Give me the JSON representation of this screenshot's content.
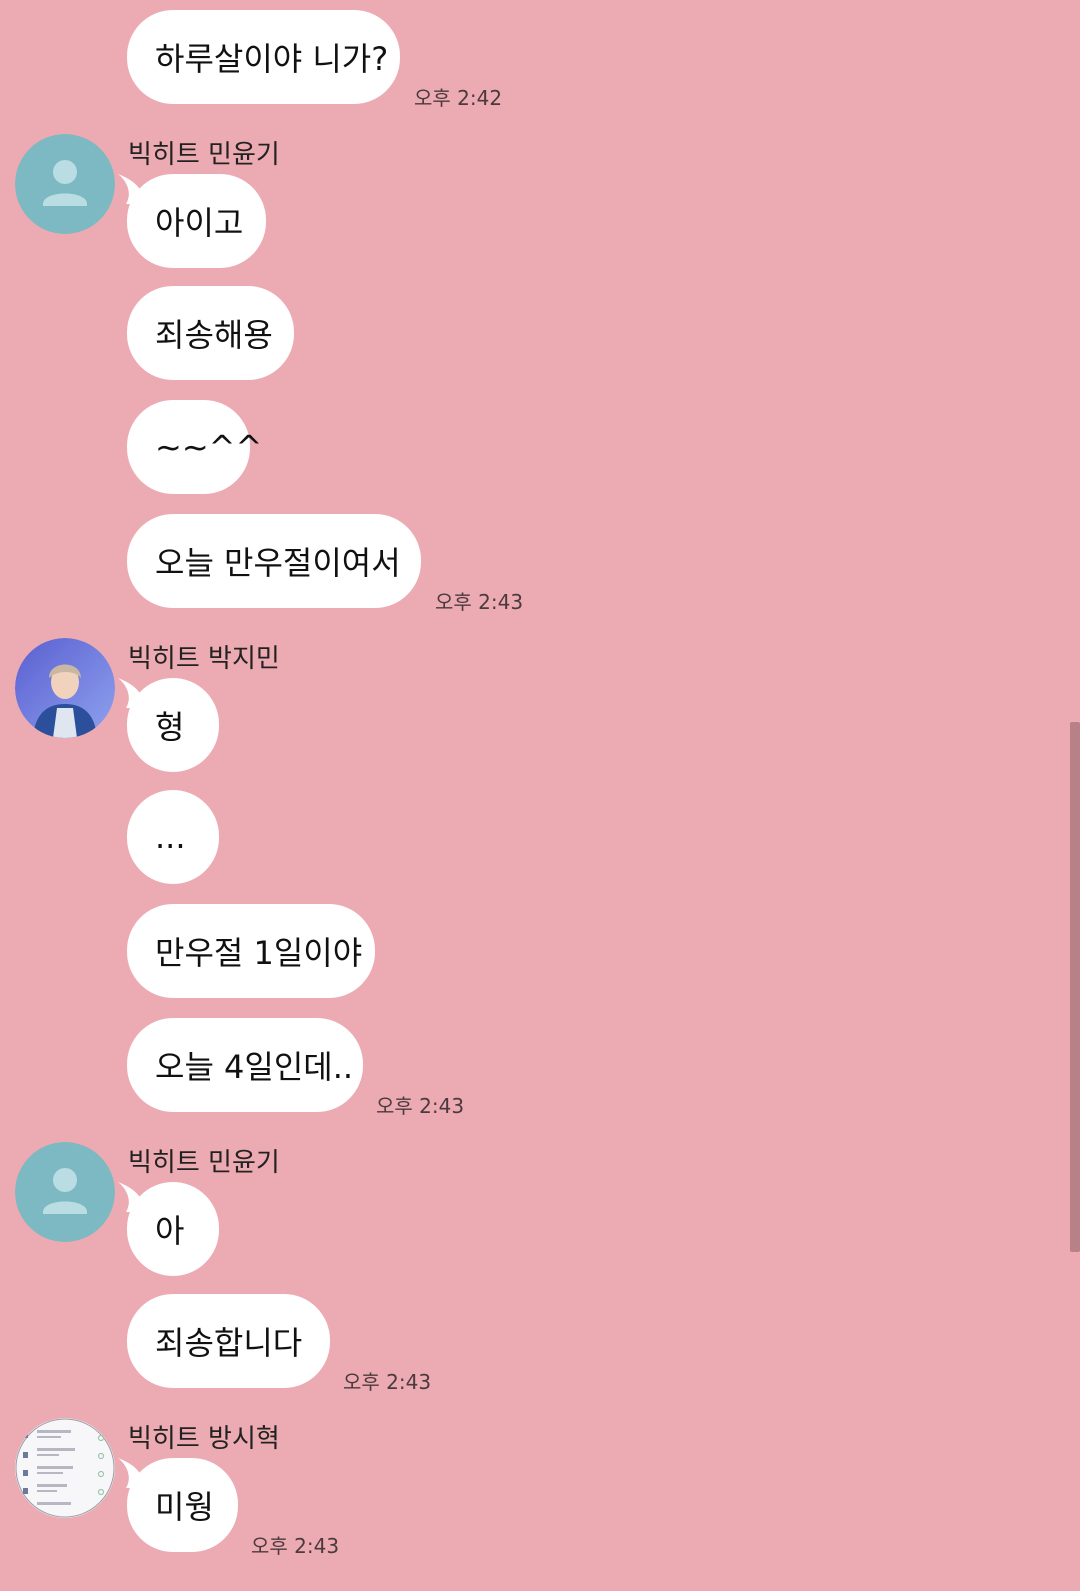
{
  "colors": {
    "background": "#ecaab2",
    "bubble": "#ffffff",
    "default_avatar": "#7db9c3",
    "scrollbar": "#b88187"
  },
  "messages": [
    {
      "text": "하루살이야 니가?",
      "time": "오후 2:42"
    },
    {
      "sender": "빅히트 민윤기",
      "avatar": "default-profile-icon",
      "text": "아이고"
    },
    {
      "text": "죄송해용"
    },
    {
      "text": "~~^^"
    },
    {
      "text": "오늘 만우절이여서",
      "time": "오후 2:43"
    },
    {
      "sender": "빅히트 박지민",
      "avatar": "profile-photo",
      "text": "형"
    },
    {
      "text": "..."
    },
    {
      "text": "만우절 1일이야"
    },
    {
      "text": "오늘 4일인데..",
      "time": "오후 2:43"
    },
    {
      "sender": "빅히트 민윤기",
      "avatar": "default-profile-icon",
      "text": "아"
    },
    {
      "text": "죄송합니다",
      "time": "오후 2:43"
    },
    {
      "sender": "빅히트 방시혁",
      "avatar": "list-screenshot-photo",
      "text": "미웡",
      "time": "오후 2:43"
    }
  ]
}
